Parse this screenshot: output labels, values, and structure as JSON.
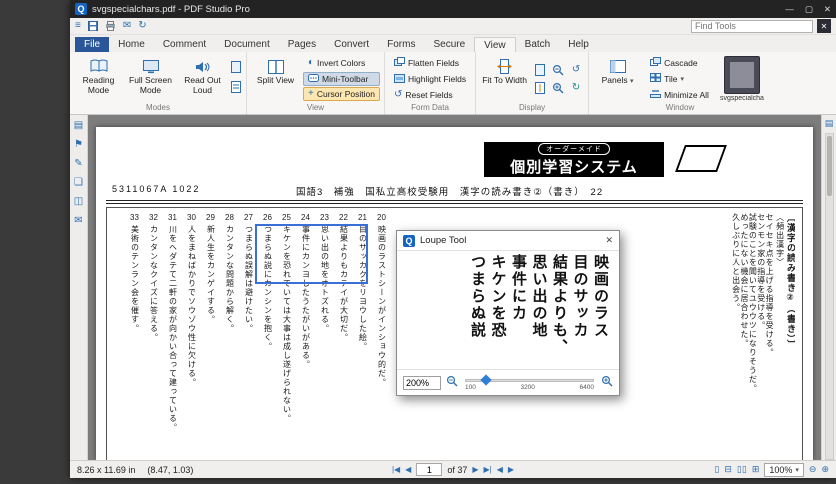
{
  "window": {
    "title": "svgspecialchars.pdf - PDF Studio Pro"
  },
  "titlebar_controls": {
    "minimize": "—",
    "maximize": "▢",
    "close": "✕"
  },
  "quick_toolbar": {
    "find_placeholder": "Find Tools",
    "close_glyph": "✕"
  },
  "ribbon": {
    "tabs": [
      "File",
      "Home",
      "Comment",
      "Document",
      "Pages",
      "Convert",
      "Forms",
      "Secure",
      "View",
      "Batch",
      "Help"
    ],
    "modes": {
      "label": "Modes",
      "reading": "Reading Mode",
      "fullscreen": "Full Screen Mode",
      "readout": "Read Out Loud"
    },
    "view": {
      "label": "View",
      "split": "Split View",
      "invert": "Invert Colors",
      "minitoolbar": "Mini-Toolbar",
      "cursor": "Cursor Position"
    },
    "form": {
      "label": "Form Data",
      "flatten": "Flatten Fields",
      "highlight": "Highlight Fields",
      "reset": "Reset Fields"
    },
    "display": {
      "label": "Display",
      "fit": "Fit To Width"
    },
    "window_group": {
      "label": "Window",
      "panels": "Panels",
      "cascade": "Cascade",
      "tile": "Tile",
      "minimize_all": "Minimize All",
      "thumbnail_label": "svgspecialchars"
    }
  },
  "document": {
    "brand_small": "オーダーメイド",
    "brand_large": "個別学習システム",
    "doc_number": "5311067A 1022",
    "header_line": "国語3　補強　国私立高校受験用　漢字の読み書き②（書き）　22",
    "columns": [
      {
        "num": "33",
        "text": "美術のテンラン会を催す。"
      },
      {
        "num": "32",
        "text": "カンタンなクイズに答える。"
      },
      {
        "num": "31",
        "text": "川をヘダテて二軒の家が向かい合って建っている。"
      },
      {
        "num": "30",
        "text": "人をまねばかりでソウゾウ性に欠ける。"
      },
      {
        "num": "29",
        "text": "新人生をカンゲイする。"
      },
      {
        "num": "28",
        "text": "カンタンな問題から解く。"
      },
      {
        "num": "27",
        "text": "つまらぬ誤解は避けたい。"
      },
      {
        "num": "26",
        "text": "つまらぬ説にカンシンを抱く。"
      },
      {
        "num": "25",
        "text": "キケンを恐れていては大事は成し遂げられない。"
      },
      {
        "num": "24",
        "text": "事件にカンヨしたうたがいがある。"
      },
      {
        "num": "23",
        "text": "思い出の地をオトズれる。"
      },
      {
        "num": "22",
        "text": "結果よりもカテイが大切だ。"
      },
      {
        "num": "21",
        "text": "目のサッカクをリヨウした絵。"
      },
      {
        "num": "20",
        "text": "映画のラストシーンがインショウ的だ。"
      }
    ],
    "section_title": "〔漢字の読み書き②（書き）〕",
    "section_sub": "〈頻出漢字〉",
    "right_columns": [
      "セイセキ点を上げる指導を受ける。",
      "センモン家の指導を受ける。",
      "試験のことを聞いてユウウツになりそうだ。",
      "めったにない機会に居合わせた。",
      "久しぶりに人と出会う。"
    ]
  },
  "loupe": {
    "title": "Loupe Tool",
    "zoom_value": "200%",
    "lines": [
      "映画のラス",
      "目のサッカ",
      "結果よりも、",
      "思い出の地",
      "事件にカ",
      "キケンを恐",
      "つまらぬ説"
    ],
    "slider_labels": [
      "100",
      "3200",
      "6400"
    ]
  },
  "status": {
    "page_size": "8.26 x 11.69 in",
    "coords": "(8.47, 1.03)",
    "page_value": "1",
    "page_of": "of 37",
    "zoom": "100%"
  },
  "icons": {
    "menu": "≡",
    "email": "✉",
    "refresh": "↻",
    "invert": "◐",
    "crosshair": "+",
    "rotate_left": "↺",
    "rotate_right": "↻",
    "thumbnails": "▤",
    "bookmarks": "⚑",
    "signatures": "✎",
    "attachments": "❏",
    "layers": "◫",
    "comments": "✉",
    "panel_toggle": "▤",
    "nav_first": "|◀",
    "nav_prev": "◀",
    "nav_next": "▶",
    "nav_last": "▶|",
    "hist_back": "◀",
    "hist_fwd": "▶",
    "layout_single": "▯",
    "layout_cont": "⊟",
    "layout_facing": "▯▯",
    "layout_grid": "⊞",
    "zoom_out": "⊖",
    "zoom_in": "⊕",
    "caret": "▾"
  }
}
